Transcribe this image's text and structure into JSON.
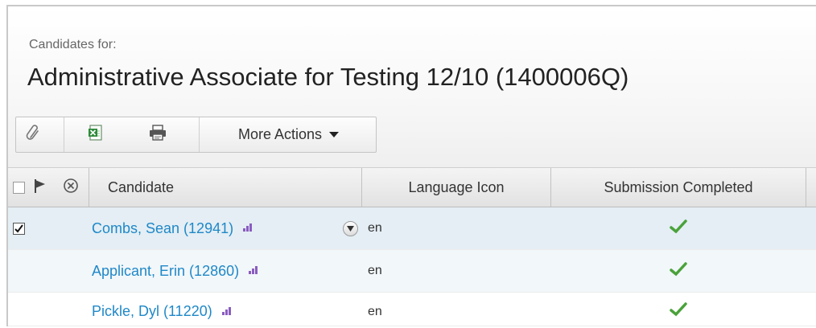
{
  "header": {
    "subtitle": "Candidates for:",
    "title": "Administrative Associate for Testing 12/10 (1400006Q)"
  },
  "toolbar": {
    "buttons": [
      {
        "icon": "paperclip-icon"
      },
      {
        "icon": "excel-export-icon"
      },
      {
        "icon": "printer-icon"
      }
    ],
    "more_actions_label": "More Actions"
  },
  "table": {
    "columns": {
      "select_all": "",
      "flag_icon": "flag-icon",
      "remove_icon": "circle-x-icon",
      "candidate": "Candidate",
      "language": "Language Icon",
      "submission": "Submission Completed"
    },
    "rows": [
      {
        "candidate": "Combs, Sean (12941)",
        "language": "en",
        "submission_completed": true,
        "checked": true,
        "has_expander": true
      },
      {
        "candidate": "Applicant, Erin (12860)",
        "language": "en",
        "submission_completed": true,
        "checked": false,
        "has_expander": false
      },
      {
        "candidate": "Pickle, Dyl (11220)",
        "language": "en",
        "submission_completed": true,
        "checked": false,
        "has_expander": false
      }
    ]
  },
  "colors": {
    "link": "#1f88c8",
    "check": "#3a9c3a",
    "rank_icon": "#8a5cc0",
    "selected_row": "#e4eef4"
  }
}
